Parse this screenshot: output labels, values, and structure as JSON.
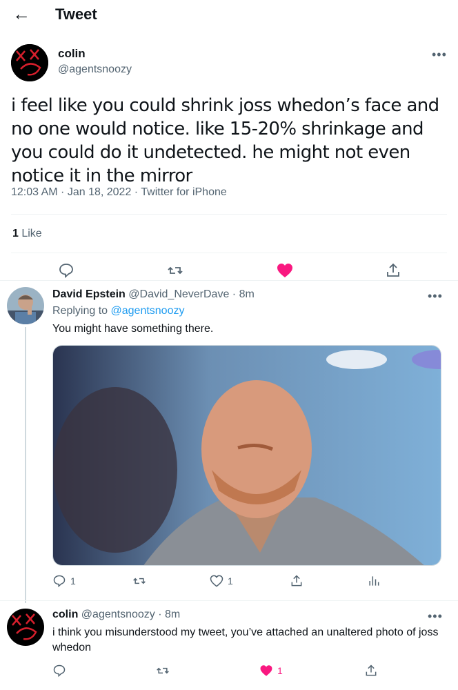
{
  "header": {
    "back_icon": "arrow-left-icon",
    "title": "Tweet"
  },
  "main_tweet": {
    "name": "colin",
    "handle": "@agentsnoozy",
    "text": "i feel like you could shrink joss whedon’s face and no one would notice. like 15-20% shrinkage and you could do it undetected. he might not even notice it in the mirror",
    "timestamp": "12:03 AM · Jan 18, 2022 · Twitter for iPhone",
    "likes_count": "1",
    "likes_label": " Like",
    "liked": true,
    "like_color": "#f91880"
  },
  "replies": [
    {
      "name": "David Epstein",
      "handle": "@David_NeverDave",
      "time": " · 8m",
      "replying_to_prefix": "Replying to ",
      "replying_to": "@agentsnoozy",
      "text": "You might have something there.",
      "reply_count": "1",
      "like_count": "1"
    },
    {
      "name": "colin",
      "handle": "@agentsnoozy",
      "time": " · 8m",
      "text": "i think you misunderstood my tweet, you’ve attached an unaltered photo of joss whedon",
      "like_count": "1"
    }
  ],
  "colors": {
    "accent": "#1d9bf0",
    "like": "#f91880",
    "secondary_text": "#536471"
  }
}
